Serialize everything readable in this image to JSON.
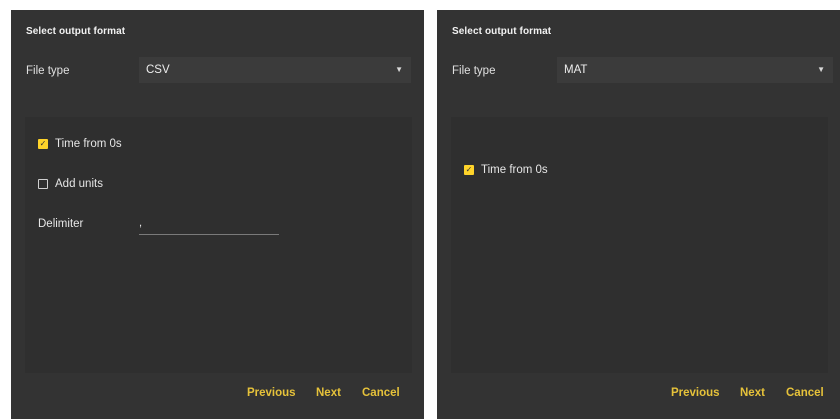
{
  "dialogs": [
    {
      "title": "Select output format",
      "file_type_label": "File type",
      "file_type_value": "CSV",
      "options": {
        "time_from_0s": {
          "label": "Time from 0s",
          "checked": true
        },
        "add_units": {
          "label": "Add units",
          "checked": false
        },
        "delimiter": {
          "label": "Delimiter",
          "value": ","
        }
      },
      "buttons": {
        "previous": "Previous",
        "next": "Next",
        "cancel": "Cancel"
      }
    },
    {
      "title": "Select output format",
      "file_type_label": "File type",
      "file_type_value": "MAT",
      "options": {
        "time_from_0s": {
          "label": "Time from 0s",
          "checked": true
        }
      },
      "buttons": {
        "previous": "Previous",
        "next": "Next",
        "cancel": "Cancel"
      }
    }
  ],
  "colors": {
    "dialog_bg": "#333333",
    "panel_bg": "#2f2f2f",
    "accent": "#ffd42a",
    "button_text": "#e6c23a"
  },
  "icons": {
    "dropdown": "chevron-down-icon",
    "checked": "checkbox-checked-icon",
    "unchecked": "checkbox-unchecked-icon"
  }
}
